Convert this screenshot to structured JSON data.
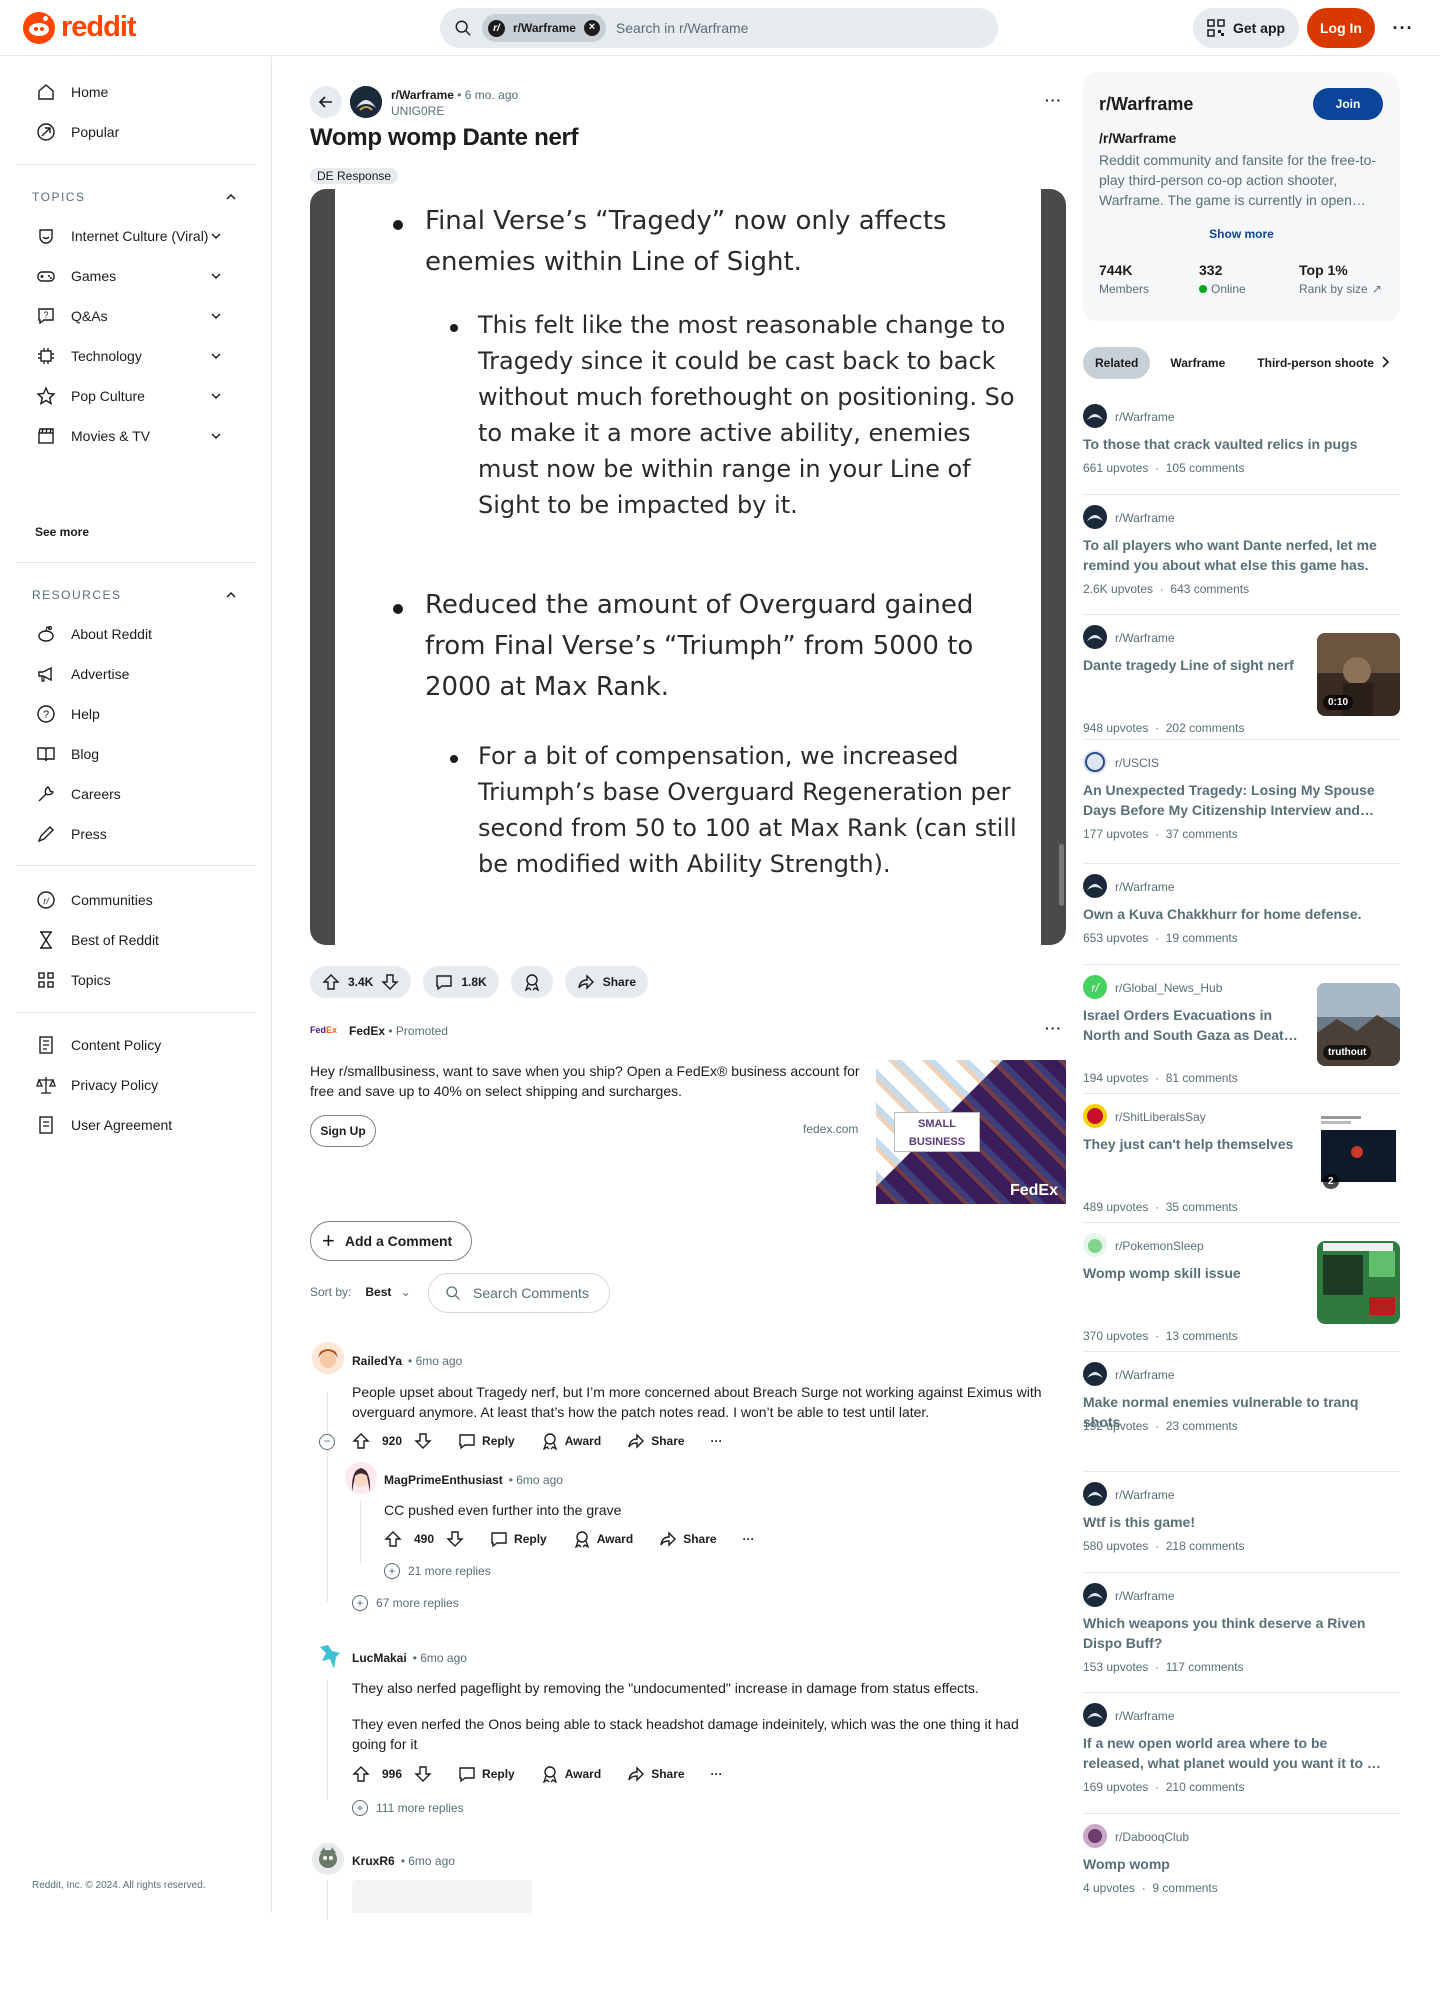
{
  "header": {
    "logo_text": "reddit",
    "search_chip": "r/Warframe",
    "search_placeholder": "Search in r/Warframe",
    "get_app": "Get app",
    "login": "Log In",
    "more": "···"
  },
  "sidebar": {
    "main": [
      {
        "label": "Home",
        "icon": "home-icon"
      },
      {
        "label": "Popular",
        "icon": "popular-icon"
      }
    ],
    "topics_header": "TOPICS",
    "topics": [
      {
        "label": "Internet Culture (Viral)",
        "icon": "smile-icon"
      },
      {
        "label": "Games",
        "icon": "gamepad-icon"
      },
      {
        "label": "Q&As",
        "icon": "qa-icon"
      },
      {
        "label": "Technology",
        "icon": "chip-icon"
      },
      {
        "label": "Pop Culture",
        "icon": "star-icon"
      },
      {
        "label": "Movies & TV",
        "icon": "clapper-icon"
      }
    ],
    "see_more": "See more",
    "resources_header": "RESOURCES",
    "resources": [
      {
        "label": "About Reddit",
        "icon": "reddit-icon"
      },
      {
        "label": "Advertise",
        "icon": "megaphone-icon"
      },
      {
        "label": "Help",
        "icon": "help-icon"
      },
      {
        "label": "Blog",
        "icon": "book-icon"
      },
      {
        "label": "Careers",
        "icon": "wrench-icon"
      },
      {
        "label": "Press",
        "icon": "pen-icon"
      }
    ],
    "community": [
      {
        "label": "Communities",
        "icon": "communities-icon"
      },
      {
        "label": "Best of Reddit",
        "icon": "hourglass-icon"
      },
      {
        "label": "Topics",
        "icon": "grid-icon"
      }
    ],
    "policy": [
      {
        "label": "Content Policy",
        "icon": "policy-icon"
      },
      {
        "label": "Privacy Policy",
        "icon": "scale-icon"
      },
      {
        "label": "User Agreement",
        "icon": "agreement-icon"
      }
    ],
    "copyright": "Reddit, Inc. © 2024. All rights reserved."
  },
  "post": {
    "subreddit": "r/Warframe",
    "time": "• 6 mo. ago",
    "author": "UNIG0RE",
    "title": "Womp womp Dante nerf",
    "flair": "DE Response",
    "image_text": {
      "b1": "Final Verse’s “Tragedy” now only affects enemies within Line of Sight.",
      "b1a": "This felt like the most reasonable change to Tragedy since it could be cast back to back without much forethought on positioning. So to make it a more active ability, enemies must now be within range in your Line of Sight to be impacted by it.",
      "b2": "Reduced the amount of Overguard gained from Final Verse’s “Triumph” from 5000 to 2000 at Max Rank.",
      "b2a": "For a bit of compensation, we increased Triumph’s base Overguard Regeneration per second from 50 to 100 at Max Rank (can still be modified with Ability Strength)."
    },
    "votes": "3.4K",
    "comments": "1.8K",
    "share": "Share"
  },
  "ad": {
    "logo": "FedEx",
    "name": "FedEx",
    "promoted": "• Promoted",
    "text": "Hey r/smallbusiness, want to save when you ship? Open a FedEx® business account for free and save up to 40% on select shipping and surcharges.",
    "cta": "Sign Up",
    "domain": "fedex.com",
    "image_caption": "SMALL BUSINESS",
    "image_brand": "FedEx"
  },
  "comments_ui": {
    "add": "Add a Comment",
    "sort_label": "Sort by:",
    "sort_value": "Best",
    "search_placeholder": "Search Comments"
  },
  "comments": [
    {
      "user": "RailedYa",
      "time": "• 6mo ago",
      "text": "People upset about Tragedy nerf, but I’m more concerned about Breach Surge not working against Eximus with overguard anymore. At least that’s how the patch notes read. I won’t be able to test until later.",
      "votes": "920",
      "more": "67 more replies"
    },
    {
      "user": "MagPrimeEnthusiast",
      "time": "• 6mo ago",
      "text": "CC pushed even further into the grave",
      "votes": "490",
      "more": "21 more replies"
    },
    {
      "user": "LucMakai",
      "time": "• 6mo ago",
      "text": "They also nerfed pageflight by removing the \"undocumented\" increase in damage from status effects.",
      "text2": "They even nerfed the Onos being able to stack headshot damage indeinitely, which was the one thing it had going for it",
      "votes": "996",
      "more": "111 more replies"
    },
    {
      "user": "KruxR6",
      "time": "• 6mo ago"
    }
  ],
  "comment_actions": {
    "reply": "Reply",
    "award": "Award",
    "share": "Share",
    "more": "···"
  },
  "community_card": {
    "title": "r/Warframe",
    "join": "Join",
    "subtitle": "/r/Warframe",
    "description": "Reddit community and fansite for the free-to-play third-person co-op action shooter, Warframe. The game is currently in open…",
    "show_more": "Show more",
    "members": "744K",
    "members_label": "Members",
    "online": "332",
    "online_label": "Online",
    "rank": "Top 1%",
    "rank_label": "Rank by size"
  },
  "related_tabs": [
    "Related",
    "Warframe",
    "Third-person shoote"
  ],
  "related": [
    {
      "sub": "r/Warframe",
      "title": "To those that crack vaulted relics in pugs",
      "upvotes": "661 upvotes",
      "comments": "105 comments"
    },
    {
      "sub": "r/Warframe",
      "title": "To all players who want Dante nerfed, let me remind you about what else this game has.",
      "upvotes": "2.6K upvotes",
      "comments": "643 comments"
    },
    {
      "sub": "r/Warframe",
      "title": "Dante tragedy Line of sight nerf",
      "upvotes": "948 upvotes",
      "comments": "202 comments",
      "badge": "0:10"
    },
    {
      "sub": "r/USCIS",
      "title": "An Unexpected Tragedy: Losing My Spouse Days Before My Citizenship Interview and…",
      "upvotes": "177 upvotes",
      "comments": "37 comments"
    },
    {
      "sub": "r/Warframe",
      "title": "Own a Kuva Chakkhurr for home defense.",
      "upvotes": "653 upvotes",
      "comments": "19 comments"
    },
    {
      "sub": "r/Global_News_Hub",
      "title": "Israel Orders Evacuations in North and South Gaza as Deat…",
      "upvotes": "194 upvotes",
      "comments": "81 comments",
      "badge": "truthout"
    },
    {
      "sub": "r/ShitLiberalsSay",
      "title": "They just can't help themselves",
      "upvotes": "489 upvotes",
      "comments": "35 comments",
      "badge": "2"
    },
    {
      "sub": "r/PokemonSleep",
      "title": "Womp womp skill issue",
      "upvotes": "370 upvotes",
      "comments": "13 comments"
    },
    {
      "sub": "r/Warframe",
      "title": "Make normal enemies vulnerable to tranq shots",
      "upvotes": "192 upvotes",
      "comments": "23 comments"
    },
    {
      "sub": "r/Warframe",
      "title": "Wtf is this game!",
      "upvotes": "580 upvotes",
      "comments": "218 comments"
    },
    {
      "sub": "r/Warframe",
      "title": "Which weapons you think deserve a Riven Dispo Buff?",
      "upvotes": "153 upvotes",
      "comments": "117 comments"
    },
    {
      "sub": "r/Warframe",
      "title": "If a new open world area where to be released, what planet would you want it to …",
      "upvotes": "169 upvotes",
      "comments": "210 comments"
    },
    {
      "sub": "r/DabooqClub",
      "title": "Womp womp",
      "upvotes": "4 upvotes",
      "comments": "9 comments"
    }
  ],
  "colors": {
    "brand": "#ff4500",
    "login": "#d93900",
    "join": "#0a449b"
  }
}
